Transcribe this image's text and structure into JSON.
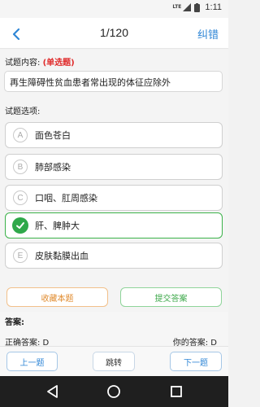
{
  "status": {
    "time": "1:11",
    "network": "LTE"
  },
  "header": {
    "counter": "1/120",
    "correct_label": "纠错"
  },
  "question": {
    "label": "试题内容:",
    "type": "(单选题)",
    "text": "再生障碍性贫血患者常出现的体征应除外"
  },
  "options": {
    "label": "试题选项:",
    "items": [
      {
        "letter": "A",
        "text": "面色苍白",
        "selected": false
      },
      {
        "letter": "B",
        "text": "肺部感染",
        "selected": false
      },
      {
        "letter": "C",
        "text": "口咽、肛周感染",
        "selected": false
      },
      {
        "letter": "D",
        "text": "肝、脾肿大",
        "selected": true
      },
      {
        "letter": "E",
        "text": "皮肤黏膜出血",
        "selected": false
      }
    ]
  },
  "actions": {
    "collect_label": "收藏本题",
    "submit_label": "提交答案"
  },
  "answer": {
    "label": "答案:",
    "correct_text": "正确答案: D",
    "yours_text": "你的答案: D"
  },
  "bottom_nav": {
    "prev_label": "上一题",
    "jump_label": "跳转",
    "next_label": "下一题"
  },
  "icons": {
    "back": "back-arrow-icon",
    "selected": "check-icon",
    "sys_back": "triangle-back-icon",
    "sys_home": "circle-home-icon",
    "sys_recent": "square-recents-icon"
  },
  "colors": {
    "accent_blue": "#2f86d6",
    "selected_green": "#2fa84a",
    "question_type_red": "#e02a2a",
    "collect_orange": "#e08a2c"
  }
}
